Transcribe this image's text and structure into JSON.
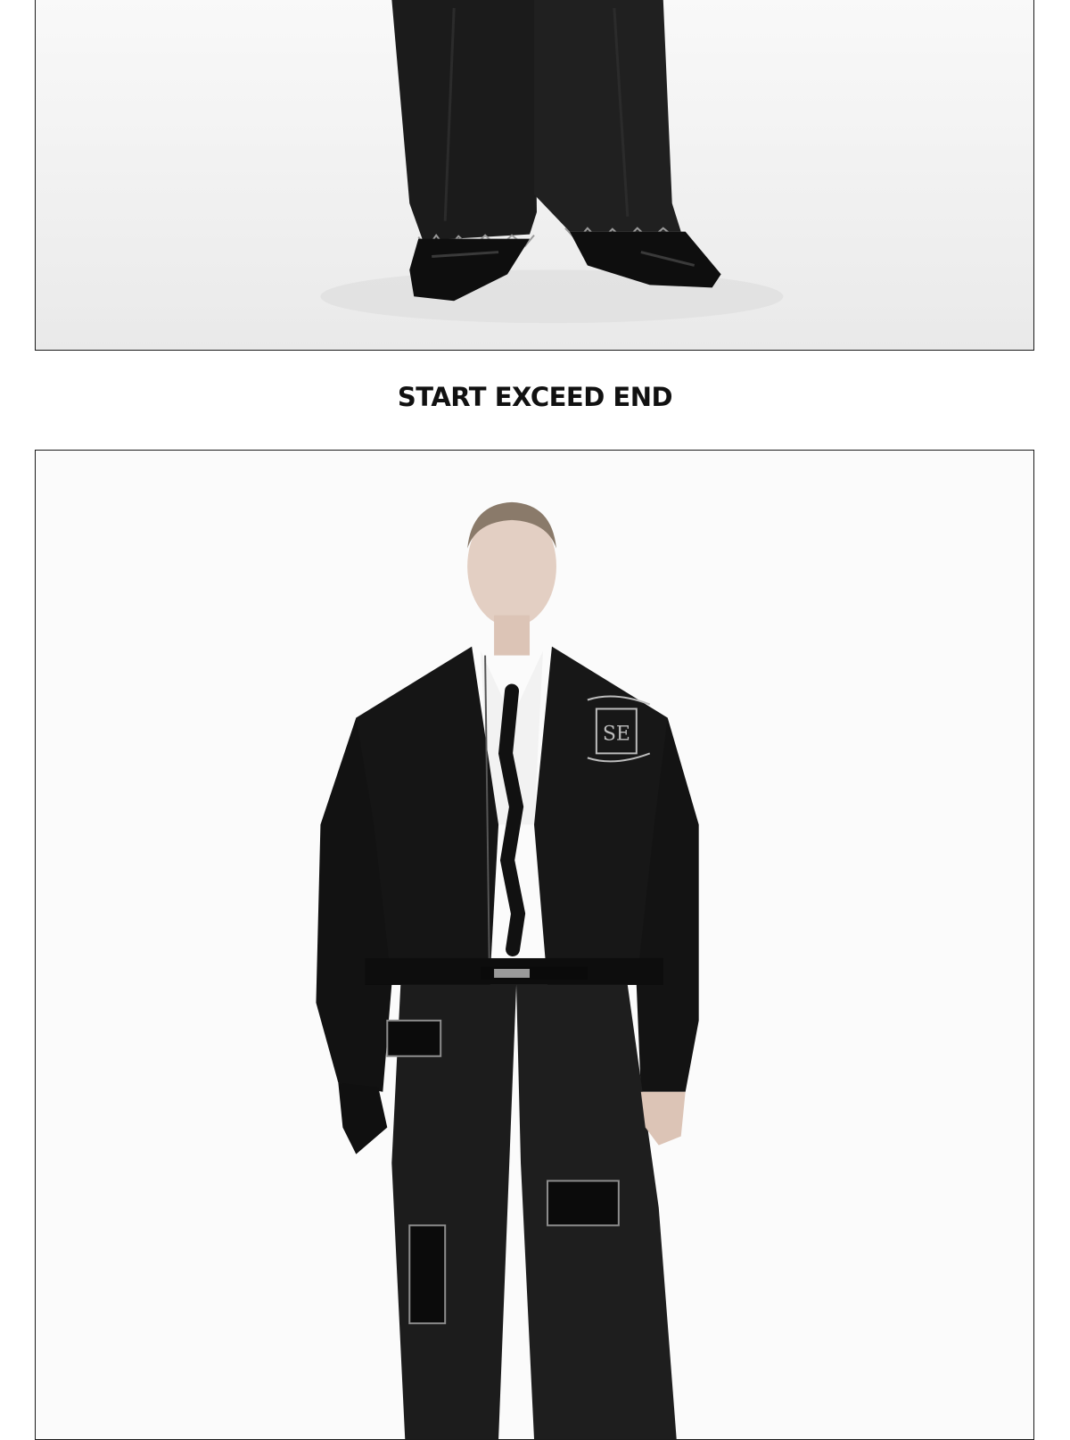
{
  "slogan": "START EXCEED END",
  "photos": [
    {
      "subject": "black wide-leg jeans with frayed hems and pointed black leather shoes"
    },
    {
      "subject": "model in black cropped leather bomber jacket with embroidered SE crest, white shirt, braided tie, patched black jeans"
    }
  ],
  "colors": {
    "background": "#ffffff",
    "frame_border": "#1a1a1a",
    "text": "#111111",
    "garment": "#141414"
  }
}
